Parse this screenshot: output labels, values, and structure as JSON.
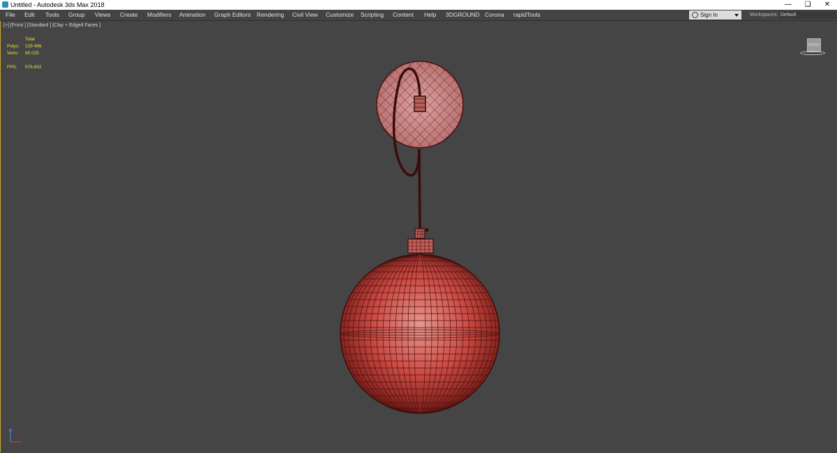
{
  "window": {
    "title": "Untitled - Autodesk 3ds Max 2018",
    "minimize_glyph": "—",
    "restore_glyph": "❏",
    "close_glyph": "✕"
  },
  "menu": {
    "items": [
      "File",
      "Edit",
      "Tools",
      "Group",
      "Views",
      "Create",
      "Modifiers",
      "Animation",
      "Graph Editors",
      "Rendering",
      "Civil View",
      "Customize",
      "Scripting",
      "Content",
      "Help",
      "3DGROUND",
      "Corona",
      "rapidTools"
    ],
    "sign_in": "Sign In",
    "workspaces_label": "Workspaces:",
    "workspace_value": "Default"
  },
  "viewport": {
    "label": "[+] [Front ] [Standard ] [Clay + Edged Faces ]",
    "stats": {
      "total_label": "Total",
      "polys_label": "Polys:",
      "polys_value": "129 496",
      "verts_label": "Verts:",
      "verts_value": "65 025",
      "fps_label": "FPS:",
      "fps_value": "576,602"
    },
    "viewcube_face": "FRONT"
  },
  "colors": {
    "accent": "#c9a834",
    "stats_text": "#e8e23a",
    "mesh_fill": "#c94a44",
    "wire": "#5a1410"
  },
  "icons": [
    "app-icon",
    "user-icon",
    "chevron-down-icon",
    "viewcube-icon",
    "axis-tripod-icon"
  ]
}
